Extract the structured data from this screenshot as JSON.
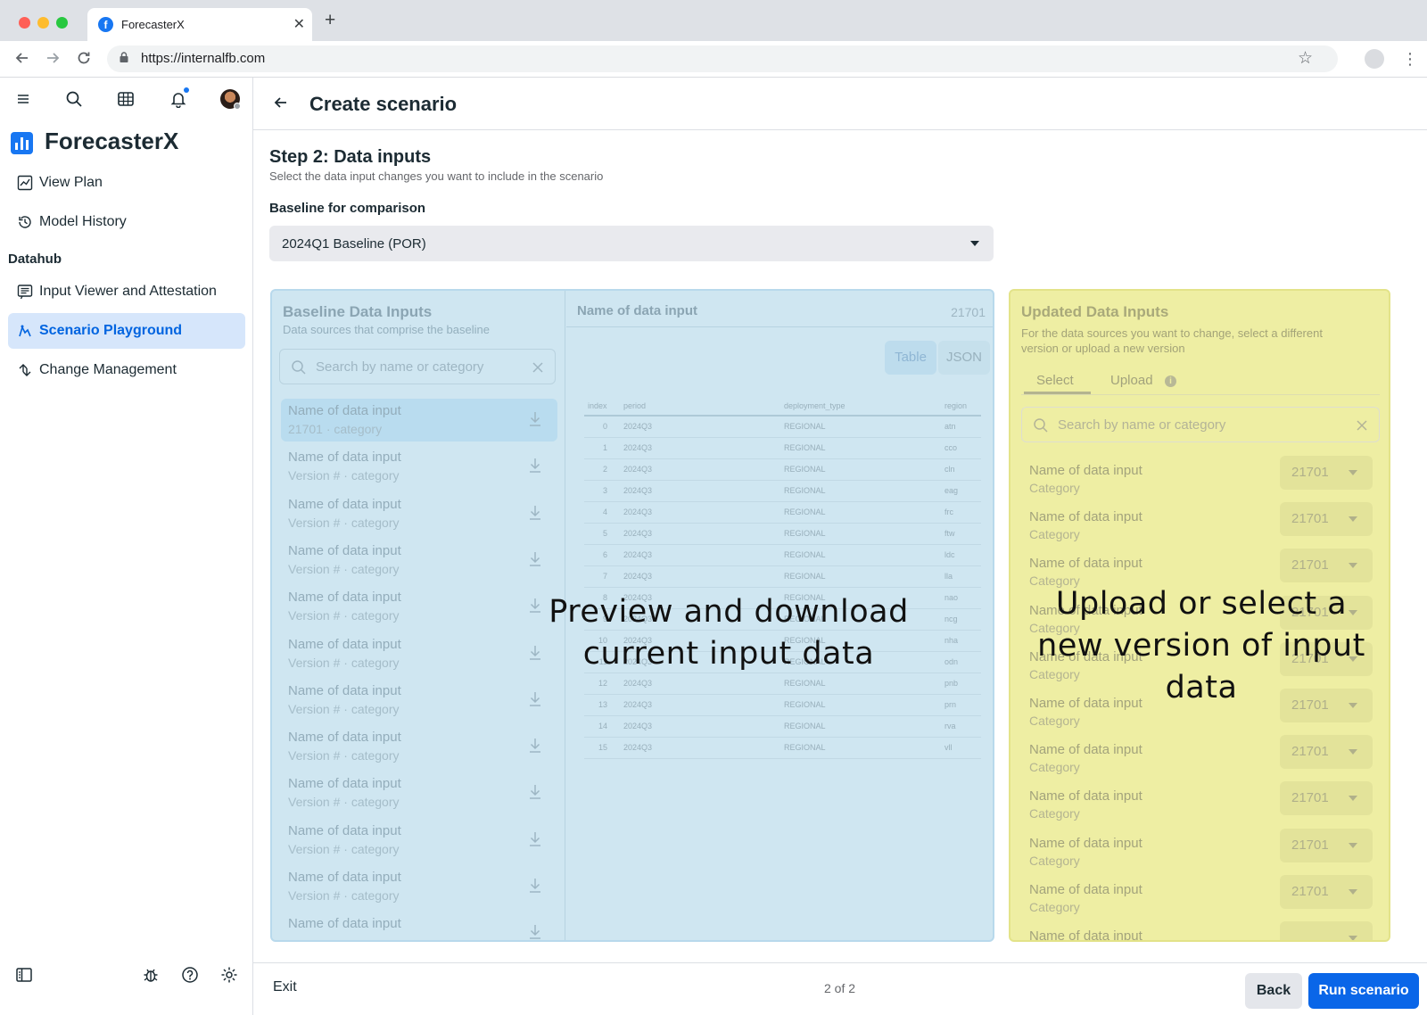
{
  "browser": {
    "tab_title": "ForecasterX",
    "url": "https://internalfb.com",
    "new_tab_symbol": "+",
    "tab_close_symbol": "✕"
  },
  "sidebar": {
    "brand": "ForecasterX",
    "items_top": [
      {
        "label": "View Plan",
        "icon": "chart-line-icon"
      },
      {
        "label": "Model History",
        "icon": "history-icon"
      }
    ],
    "section_label": "Datahub",
    "items_datahub": [
      {
        "label": "Input Viewer and Attestation",
        "icon": "list-icon"
      },
      {
        "label": "Scenario Playground",
        "icon": "playground-icon",
        "active": true
      },
      {
        "label": "Change Management",
        "icon": "change-icon"
      }
    ]
  },
  "header": {
    "title": "Create scenario"
  },
  "step": {
    "title": "Step 2: Data inputs",
    "subtitle": "Select the data input changes you want to include in the scenario",
    "baseline_label": "Baseline for comparison",
    "baseline_value": "2024Q1 Baseline (POR)"
  },
  "baseline_panel": {
    "title": "Baseline Data Inputs",
    "subtitle": "Data sources that comprise the baseline",
    "search_placeholder": "Search by name or category",
    "items": [
      {
        "name": "Name of data input",
        "sub": "21701 · category",
        "selected": true
      },
      {
        "name": "Name of data input",
        "sub": "Version # · category"
      },
      {
        "name": "Name of data input",
        "sub": "Version # · category"
      },
      {
        "name": "Name of data input",
        "sub": "Version # · category"
      },
      {
        "name": "Name of data input",
        "sub": "Version # · category"
      },
      {
        "name": "Name of data input",
        "sub": "Version # · category"
      },
      {
        "name": "Name of data input",
        "sub": "Version # · category"
      },
      {
        "name": "Name of data input",
        "sub": "Version # · category"
      },
      {
        "name": "Name of data input",
        "sub": "Version # · category"
      },
      {
        "name": "Name of data input",
        "sub": "Version # · category"
      },
      {
        "name": "Name of data input",
        "sub": "Version # · category"
      },
      {
        "name": "Name of data input",
        "sub": ""
      }
    ],
    "preview": {
      "title": "Name of data input",
      "version": "21701",
      "toggle": [
        "Table",
        "JSON"
      ],
      "columns": [
        "index",
        "period",
        "deployment_type",
        "region"
      ],
      "rows": [
        [
          "0",
          "2024Q3",
          "REGIONAL",
          "atn"
        ],
        [
          "1",
          "2024Q3",
          "REGIONAL",
          "cco"
        ],
        [
          "2",
          "2024Q3",
          "REGIONAL",
          "cln"
        ],
        [
          "3",
          "2024Q3",
          "REGIONAL",
          "eag"
        ],
        [
          "4",
          "2024Q3",
          "REGIONAL",
          "frc"
        ],
        [
          "5",
          "2024Q3",
          "REGIONAL",
          "ftw"
        ],
        [
          "6",
          "2024Q3",
          "REGIONAL",
          "ldc"
        ],
        [
          "7",
          "2024Q3",
          "REGIONAL",
          "lla"
        ],
        [
          "8",
          "2024Q3",
          "REGIONAL",
          "nao"
        ],
        [
          "9",
          "2024Q3",
          "REGIONAL",
          "ncg"
        ],
        [
          "10",
          "2024Q3",
          "REGIONAL",
          "nha"
        ],
        [
          "11",
          "2024Q3",
          "REGIONAL",
          "odn"
        ],
        [
          "12",
          "2024Q3",
          "REGIONAL",
          "pnb"
        ],
        [
          "13",
          "2024Q3",
          "REGIONAL",
          "prn"
        ],
        [
          "14",
          "2024Q3",
          "REGIONAL",
          "rva"
        ],
        [
          "15",
          "2024Q3",
          "REGIONAL",
          "vll"
        ]
      ]
    }
  },
  "updated_panel": {
    "title": "Updated Data Inputs",
    "subtitle": "For the data sources you want to change, select a different version or upload a new version",
    "tabs": [
      "Select",
      "Upload"
    ],
    "search_placeholder": "Search by name or category",
    "items": [
      {
        "name": "Name of data input",
        "category": "Category",
        "version": "21701"
      },
      {
        "name": "Name of data input",
        "category": "Category",
        "version": "21701"
      },
      {
        "name": "Name of data input",
        "category": "Category",
        "version": "21701"
      },
      {
        "name": "Name of data input",
        "category": "Category",
        "version": "21701"
      },
      {
        "name": "Name of data input",
        "category": "Category",
        "version": "21701"
      },
      {
        "name": "Name of data input",
        "category": "Category",
        "version": "21701"
      },
      {
        "name": "Name of data input",
        "category": "Category",
        "version": "21701"
      },
      {
        "name": "Name of data input",
        "category": "Category",
        "version": "21701"
      },
      {
        "name": "Name of data input",
        "category": "Category",
        "version": "21701"
      },
      {
        "name": "Name of data input",
        "category": "Category",
        "version": "21701"
      },
      {
        "name": "Name of data input",
        "category": "",
        "version": ""
      }
    ]
  },
  "annotations": {
    "left": "Preview and download current input data",
    "right": "Upload or select a new version of input data"
  },
  "footer": {
    "exit": "Exit",
    "pager": "2 of 2",
    "back": "Back",
    "run": "Run scenario"
  },
  "colors": {
    "accent": "#0a66e8",
    "active_nav_bg": "#d6e6fb",
    "blue_overlay": "#cfe6f1",
    "yellow_overlay": "#eeeea3"
  }
}
